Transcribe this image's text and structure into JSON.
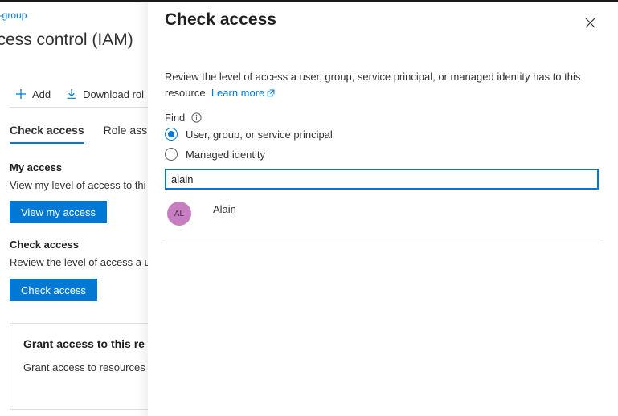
{
  "blade": {
    "breadcrumb": "e-group",
    "title": "ccess control (IAM)",
    "toolbar": [
      {
        "label": "Add",
        "icon": "plus-icon"
      },
      {
        "label": "Download rol",
        "icon": "download-icon"
      }
    ],
    "tabs": [
      {
        "label": "Check access",
        "active": true
      },
      {
        "label": "Role assign",
        "active": false
      }
    ],
    "my_access": {
      "heading": "My access",
      "description": "View my level of access to thi",
      "button": "View my access"
    },
    "check_access": {
      "heading": "Check access",
      "description": "Review the level of access a u",
      "button": "Check access"
    },
    "grant_card": {
      "heading": "Grant access to this re",
      "description": "Grant access to resources b"
    }
  },
  "panel": {
    "title": "Check access",
    "close_label": "Close",
    "description_prefix": "Review the level of access a user, group, service principal, or managed identity has to this resource. ",
    "learn_more": "Learn more",
    "find_label": "Find",
    "options": [
      {
        "label": "User, group, or service principal",
        "selected": true
      },
      {
        "label": "Managed identity",
        "selected": false
      }
    ],
    "search": {
      "value": "alain",
      "placeholder": ""
    },
    "results": [
      {
        "initials": "AL",
        "name": "Alain"
      }
    ]
  },
  "colors": {
    "accent": "#0078d4",
    "avatar": "#c77ec0",
    "text": "#323130",
    "divider": "#c8c6c4"
  }
}
